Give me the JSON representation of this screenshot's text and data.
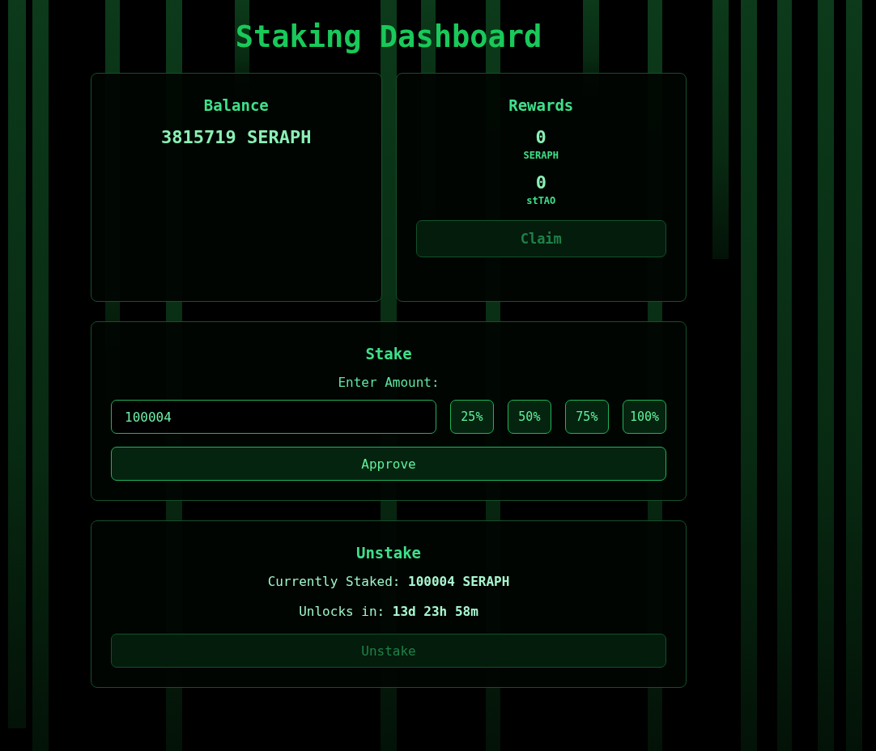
{
  "title": "Staking Dashboard",
  "balance": {
    "heading": "Balance",
    "amount": "3815719 SERAPH"
  },
  "rewards": {
    "heading": "Rewards",
    "tokens": [
      {
        "amount": "0",
        "symbol": "SERAPH"
      },
      {
        "amount": "0",
        "symbol": "stTAO"
      }
    ],
    "claim_button": {
      "label": "Claim",
      "disabled": true
    }
  },
  "stake": {
    "heading": "Stake",
    "amount_label": "Enter Amount:",
    "amount_value": "100004",
    "percent_buttons": [
      "25%",
      "50%",
      "75%",
      "100%"
    ],
    "approve_button": {
      "label": "Approve",
      "disabled": false
    }
  },
  "unstake": {
    "heading": "Unstake",
    "staked_line": "Currently Staked: **100004 SERAPH**",
    "unlock_line": "Unlocks in: **13d 23h 58m**",
    "unstake_button": {
      "label": "Unstake",
      "disabled": true
    }
  }
}
